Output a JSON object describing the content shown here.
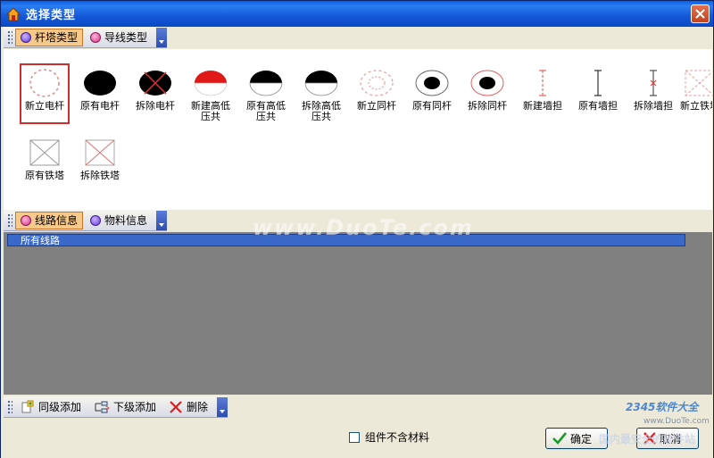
{
  "window": {
    "title": "选择类型"
  },
  "top_toolbar": {
    "tabs": [
      {
        "label": "杆塔类型",
        "active": true
      },
      {
        "label": "导线类型",
        "active": false
      }
    ]
  },
  "symbols": [
    {
      "label": "新立电杆",
      "icon": "dashed-circle-icon"
    },
    {
      "label": "原有电杆",
      "icon": "black-ellipse-icon"
    },
    {
      "label": "拆除电杆",
      "icon": "crossed-ellipse-icon"
    },
    {
      "label": "新建高低压共",
      "icon": "red-top-ellipse-icon"
    },
    {
      "label": "原有高低压共",
      "icon": "black-bottom-ellipse-icon"
    },
    {
      "label": "拆除高低压共",
      "icon": "black-bottom-ellipse-icon"
    },
    {
      "label": "新立同杆",
      "icon": "dashed-double-circle-icon"
    },
    {
      "label": "原有同杆",
      "icon": "double-circle-icon"
    },
    {
      "label": "拆除同杆",
      "icon": "double-circle-red-icon"
    },
    {
      "label": "新建墙担",
      "icon": "dashed-wall-bracket-icon"
    },
    {
      "label": "原有墙担",
      "icon": "wall-bracket-icon"
    },
    {
      "label": "拆除墙担",
      "icon": "wall-bracket-cross-icon"
    },
    {
      "label": "新立铁塔",
      "icon": "dashed-tower-icon"
    },
    {
      "label": "原有铁塔",
      "icon": "tower-icon"
    },
    {
      "label": "拆除铁塔",
      "icon": "tower-red-icon"
    }
  ],
  "middle_toolbar": {
    "tabs": [
      {
        "label": "线路信息",
        "active": true
      },
      {
        "label": "物料信息",
        "active": false
      }
    ]
  },
  "grid": {
    "header": "所有线路"
  },
  "bottom_toolbar": {
    "add_sibling": "同级添加",
    "add_child": "下级添加",
    "delete": "删除"
  },
  "footer": {
    "checkbox_label": "组件不含材料",
    "ok": "确定",
    "cancel": "取消"
  },
  "watermarks": {
    "site": "www.DuoTe.com",
    "brand": "2345软件大全",
    "brand_url": "www.DuoTe.com",
    "slogan": "国内最安全的软件站"
  },
  "colors": {
    "accent": "#f7c98a",
    "selection": "#cc2e2e",
    "titlebar": "#1458d8"
  }
}
